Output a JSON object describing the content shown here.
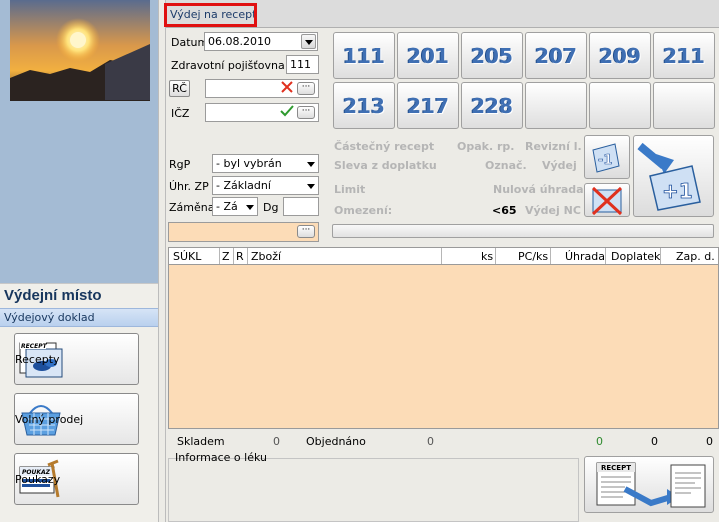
{
  "left": {
    "section_title": "Výdejní místo",
    "doc_label": "Výdejový doklad",
    "buttons": [
      {
        "label": "Recepty",
        "icon": "recept-card-icon",
        "badge": "RECEPT"
      },
      {
        "label": "Volný prodej",
        "icon": "shopping-basket-icon"
      },
      {
        "label": "Poukazy",
        "icon": "poukaz-crutch-icon",
        "badge": "POUKAZ"
      }
    ]
  },
  "tab": {
    "label": "Výdej na recept"
  },
  "form": {
    "datum_label": "Datum",
    "datum_value": "06.08.2010",
    "pojistovna_label": "Zdravotní pojišťovna",
    "pojistovna_value": "111",
    "rc_label": "RČ",
    "icz_label": "IČZ",
    "rgp_label": "RgP",
    "rgp_value": "- byl vybrán",
    "uhr_label": "Úhr. ZP",
    "uhr_value": "- Základní",
    "zamena_label": "Záměna",
    "zamena_value": "- Zá",
    "dg_label": "Dg",
    "dots": "···"
  },
  "codes": [
    "111",
    "201",
    "205",
    "207",
    "209",
    "211",
    "213",
    "217",
    "228",
    "",
    "",
    ""
  ],
  "flags": {
    "castecny": "Částečný recept",
    "opak": "Opak. rp.",
    "revizni": "Revizní l.",
    "sleva": "Sleva z doplatku",
    "oznac": "Označ.",
    "vydej": "Výdej",
    "limit": "Limit",
    "nulova": "Nulová úhrada",
    "omezeni": "Omezení:",
    "lt65": "<65",
    "vydej_nc": "Výdej NC"
  },
  "step_buttons": {
    "minus": "-1",
    "plus": "+1"
  },
  "table": {
    "columns": [
      "SÚKL",
      "Z",
      "R",
      "Zboží",
      "ks",
      "PC/ks",
      "Úhrada",
      "Doplatek",
      "Zap. d."
    ]
  },
  "status": {
    "skladem_label": "Skladem",
    "skladem_value": "0",
    "objednano_label": "Objednáno",
    "objednano_value": "0",
    "green_value": "0",
    "doplatek_value": "0",
    "zap_value": "0",
    "info_label": "Informace o léku"
  },
  "big_button": {
    "badge": "RECEPT"
  }
}
